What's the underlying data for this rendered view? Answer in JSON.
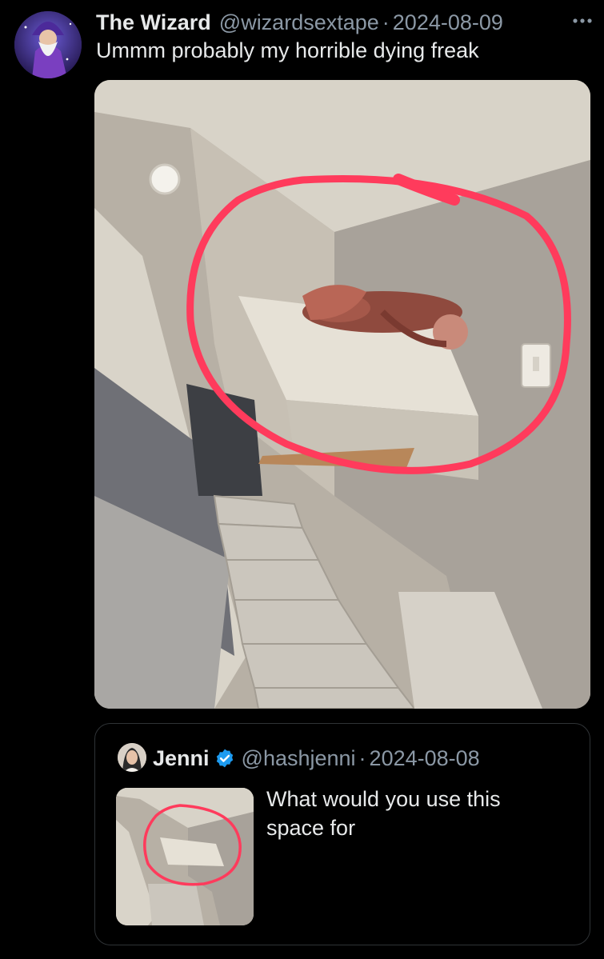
{
  "tweet": {
    "author_name": "The Wizard",
    "author_handle": "@wizardsextape",
    "separator": "·",
    "date": "2024-08-09",
    "text": "Ummm probably my horrible dying freak",
    "more_icon": "more-horizontal-icon"
  },
  "quoted": {
    "author_name": "Jenni",
    "author_handle": "@hashjenni",
    "separator": "·",
    "date": "2024-08-08",
    "text": "What would you use this space for",
    "verified_icon": "verified-badge-icon",
    "verified_color": "#1d9bf0"
  },
  "colors": {
    "background": "#000000",
    "text_primary": "#e7e9ea",
    "text_secondary": "#8b98a5",
    "border": "#2f3336",
    "circle_annotation": "#ff3b5c"
  }
}
